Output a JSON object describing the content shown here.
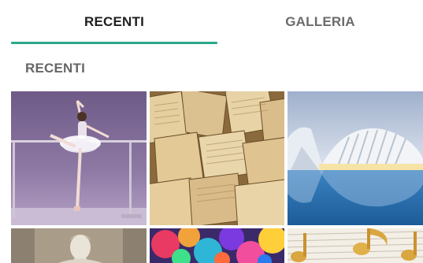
{
  "tabs": {
    "recenti_label": "RECENTI",
    "galleria_label": "GALLERIA",
    "active": "RECENTI"
  },
  "section": {
    "title": "RECENTI"
  },
  "colors": {
    "accent": "#2aa88a",
    "tab_active_text": "#1f1f1f",
    "tab_inactive_text": "#6b6b6b",
    "section_text": "#666666"
  },
  "photos": [
    {
      "name": "ballet-dancer-photo"
    },
    {
      "name": "open-books-photo"
    },
    {
      "name": "futuristic-architecture-photo"
    },
    {
      "name": "statue-photo"
    },
    {
      "name": "colorful-paint-photo"
    },
    {
      "name": "music-notes-photo"
    }
  ]
}
